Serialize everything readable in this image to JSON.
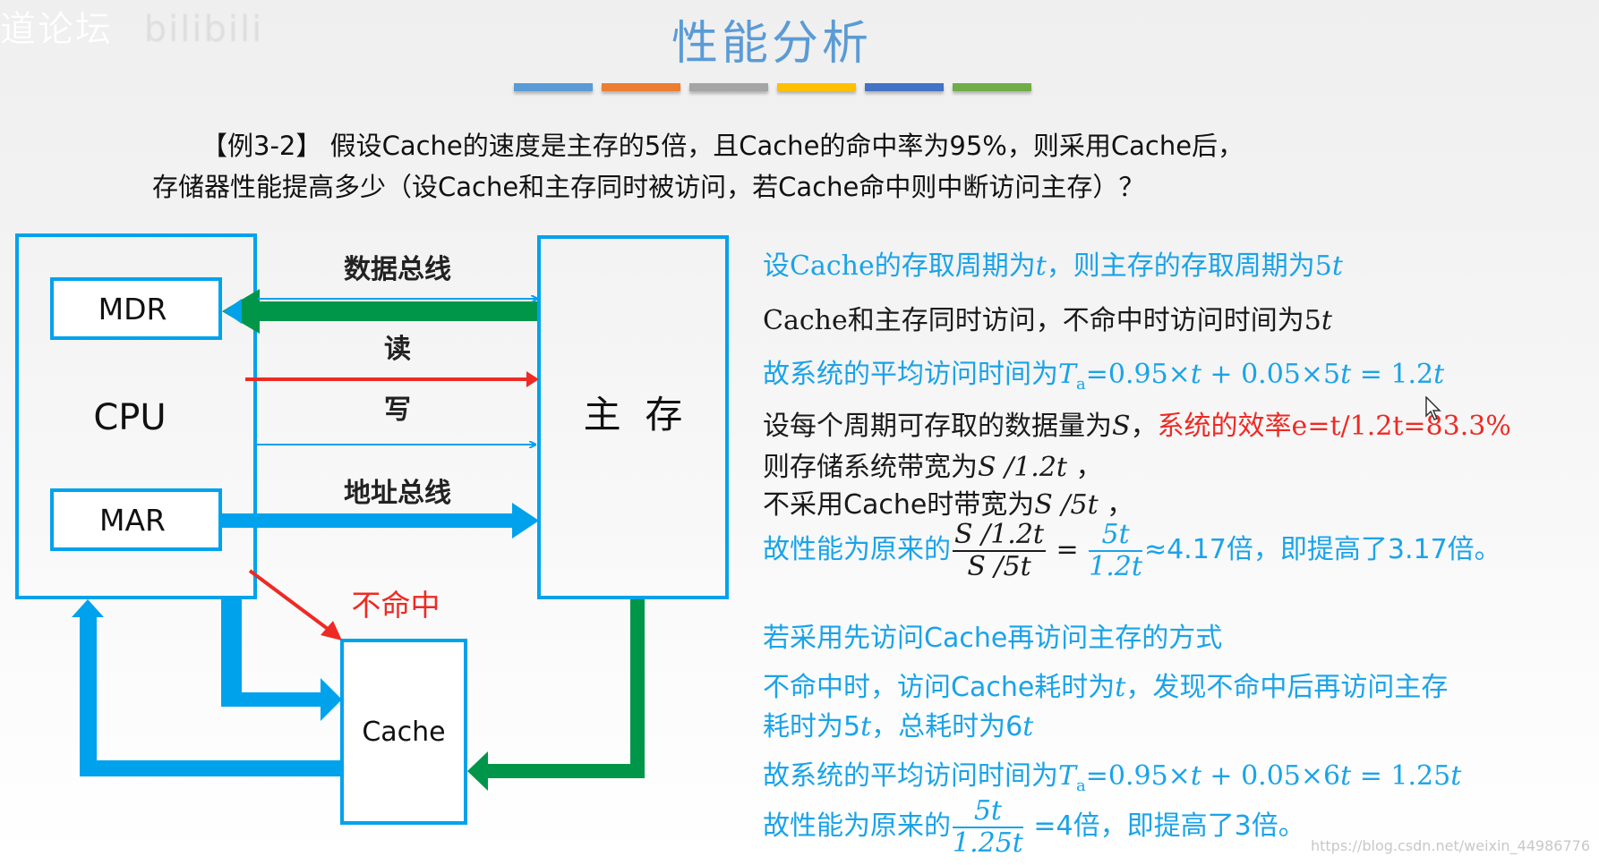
{
  "watermark_top": {
    "text": "道论坛",
    "ghost_text": "bilibili"
  },
  "title": "性能分析",
  "color_bars": [
    "#5b9bd5",
    "#ed7d31",
    "#a5a5a5",
    "#ffc000",
    "#4472c4",
    "#70ad47"
  ],
  "question": {
    "line1": "【例3-2】 假设Cache的速度是主存的5倍，且Cache的命中率为95%，则采用Cache后，",
    "line2": "存储器性能提高多少（设Cache和主存同时被访问，若Cache命中则中断访问主存）？"
  },
  "diagram": {
    "cpu_label": "CPU",
    "mdr_label": "MDR",
    "mar_label": "MAR",
    "memory_label": "主  存",
    "cache_label": "Cache",
    "data_bus_label": "数据总线",
    "read_label": "读",
    "write_label": "写",
    "address_bus_label": "地址总线",
    "miss_label": "不命中",
    "colors": {
      "blue": "#00a2ec",
      "green": "#00964a",
      "red": "#ee2a24"
    }
  },
  "solution": {
    "line1": {
      "a": "设Cache的存取周期为",
      "v1": "t",
      "b": "，则主存的存取周期为5",
      "v2": "t"
    },
    "line2": {
      "a": "Cache和主存同时访问，不命中时访问时间为5",
      "v": "t"
    },
    "line3": {
      "a": "故系统的平均访问时间为",
      "T": "T",
      "sub": "a",
      "b": "=0.95×",
      "v1": "t",
      "c": " + 0.05×5",
      "v2": "t",
      "d": " = 1.2",
      "v3": "t"
    },
    "line4": {
      "a": "设每个周期可存取的数据量为",
      "S": "S",
      "b": "，",
      "red": "系统的效率e=t/1.2t=83.3%"
    },
    "line5": {
      "a": "则存储系统带宽为",
      "expr": "S /1.2t",
      "b": " ，"
    },
    "line6": {
      "a": "不采用Cache时带宽为",
      "expr": "S /5t",
      "b": " ，"
    },
    "line7": {
      "a": "故性能为原来的",
      "frac1_num": "S /1.2t",
      "frac1_den": "S /5t",
      "eq": " = ",
      "frac2_num": "5t",
      "frac2_den": "1.2t",
      "b": "≈4.17倍，即提高了3.17倍。"
    },
    "line8": "若采用先访问Cache再访问主存的方式",
    "line9": {
      "a": "不命中时，访问Cache耗时为",
      "v": "t",
      "b": "，发现不命中后再访问主存"
    },
    "line10": {
      "a": "耗时为5",
      "v1": "t",
      "b": "，总耗时为6",
      "v2": "t"
    },
    "line11": {
      "a": "故系统的平均访问时间为",
      "T": "T",
      "sub": "a",
      "b": "=0.95×",
      "v1": "t",
      "c": " + 0.05×6",
      "v2": "t",
      "d": " = 1.25",
      "v3": "t"
    },
    "line12": {
      "a": "故性能为原来的",
      "frac_num": "5t",
      "frac_den": "1.25t",
      "b": " =4倍，即提高了3倍。"
    }
  },
  "watermark_bottom": "https://blog.csdn.net/weixin_44986776"
}
